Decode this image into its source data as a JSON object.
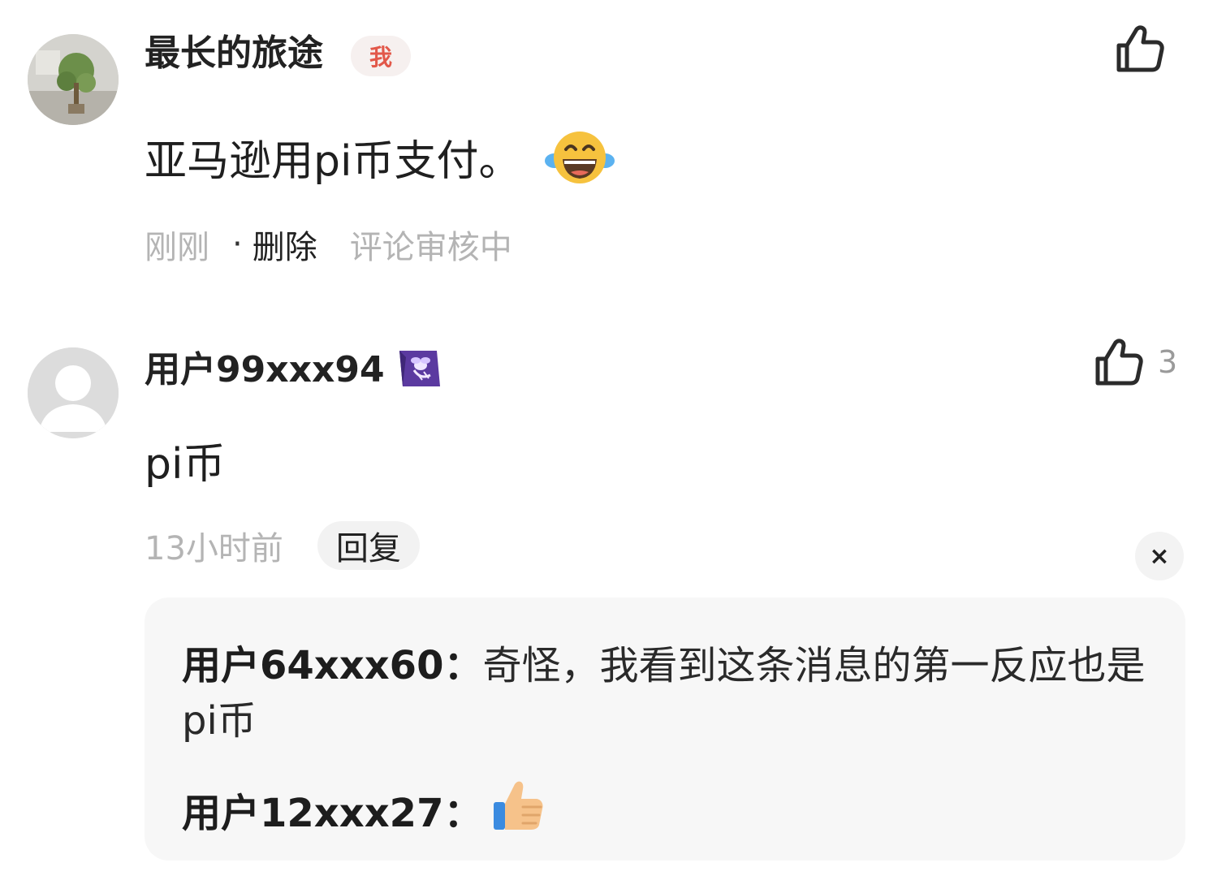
{
  "comments": [
    {
      "username": "最长的旅途",
      "badge": "我",
      "text": "亚马逊用pi币支付。",
      "emoji": "laughing-with-tears",
      "time": "刚刚",
      "separator": "·",
      "delete_label": "删除",
      "status": "评论审核中"
    },
    {
      "username": "用户99xxx94",
      "level_badge": "bee-badge",
      "likes": "3",
      "text": "pi币",
      "time": "13小时前",
      "reply_label": "回复",
      "close_label": "×",
      "replies": [
        {
          "author": "用户64xxx60：",
          "text": "奇怪，我看到这条消息的第一反应也是pi币"
        },
        {
          "author": "用户12xxx27：",
          "text": "",
          "emoji": "thumbs-up"
        }
      ]
    }
  ],
  "colors": {
    "badge_text": "#e2584a",
    "muted": "#b4b4b4",
    "reply_bg": "#f7f7f7"
  }
}
